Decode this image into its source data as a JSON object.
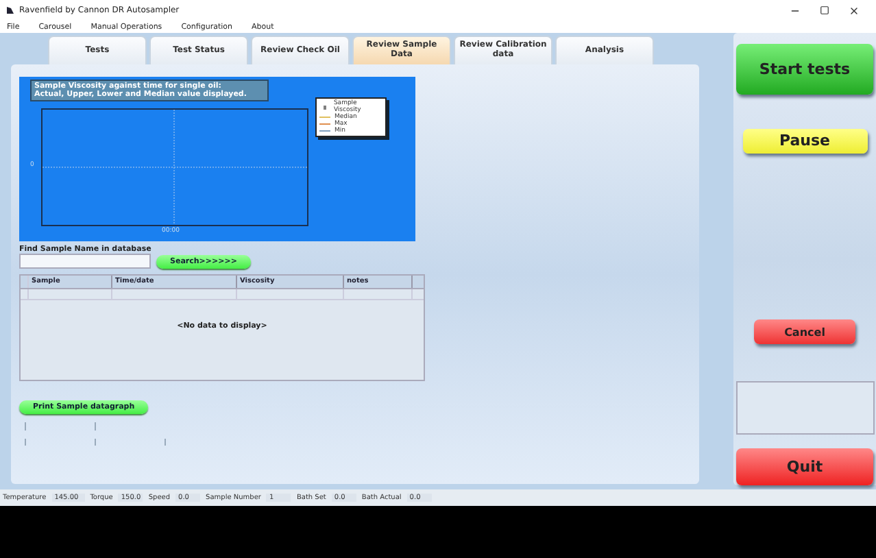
{
  "window": {
    "title": "Ravenfield by Cannon DR Autosampler"
  },
  "menu": [
    "File",
    "Carousel",
    "Manual Operations",
    "Configuration",
    "About"
  ],
  "tabs": [
    {
      "label": "Tests",
      "selected": false
    },
    {
      "label": "Test Status",
      "selected": false
    },
    {
      "label": "Review Check Oil",
      "selected": false
    },
    {
      "label": "Review Sample Data",
      "selected": true
    },
    {
      "label": "Review Calibration data",
      "selected": false
    },
    {
      "label": "Analysis",
      "selected": false
    }
  ],
  "chart": {
    "title": "Sample Viscosity against time for single oil:",
    "subtitle": "Actual, Upper, Lower and Median value displayed.",
    "y_tick": "0",
    "x_tick": "00:00",
    "legend": [
      {
        "label": "Sample Viscosity",
        "kind": "marker",
        "color": "#808080"
      },
      {
        "label": "Median",
        "kind": "line",
        "color": "#e0c060"
      },
      {
        "label": "Max",
        "kind": "line",
        "color": "#e09050"
      },
      {
        "label": "Min",
        "kind": "line",
        "color": "#80a0c0"
      }
    ]
  },
  "search": {
    "label": "Find Sample Name in database",
    "button": "Search>>>>>>"
  },
  "table": {
    "columns": [
      "Sample",
      "Time/date",
      "Viscosity",
      "notes"
    ],
    "empty_text": "<No data to display>"
  },
  "print_button": "Print Sample datagraph",
  "actions": [
    {
      "label": "Start tests",
      "kind": "start"
    },
    {
      "label": "Pause",
      "kind": "pause"
    },
    {
      "label": "Cancel",
      "kind": "cancel"
    },
    {
      "label": "Quit",
      "kind": "quit"
    }
  ],
  "status_bar": [
    {
      "label": "Temperature",
      "value": "145.00"
    },
    {
      "label": "Torque",
      "value": "150.0"
    },
    {
      "label": "Speed",
      "value": "0.0"
    },
    {
      "label": "Sample Number",
      "value": "1"
    },
    {
      "label": "Bath Set",
      "value": "0.0"
    },
    {
      "label": "Bath Actual",
      "value": "0.0"
    }
  ]
}
